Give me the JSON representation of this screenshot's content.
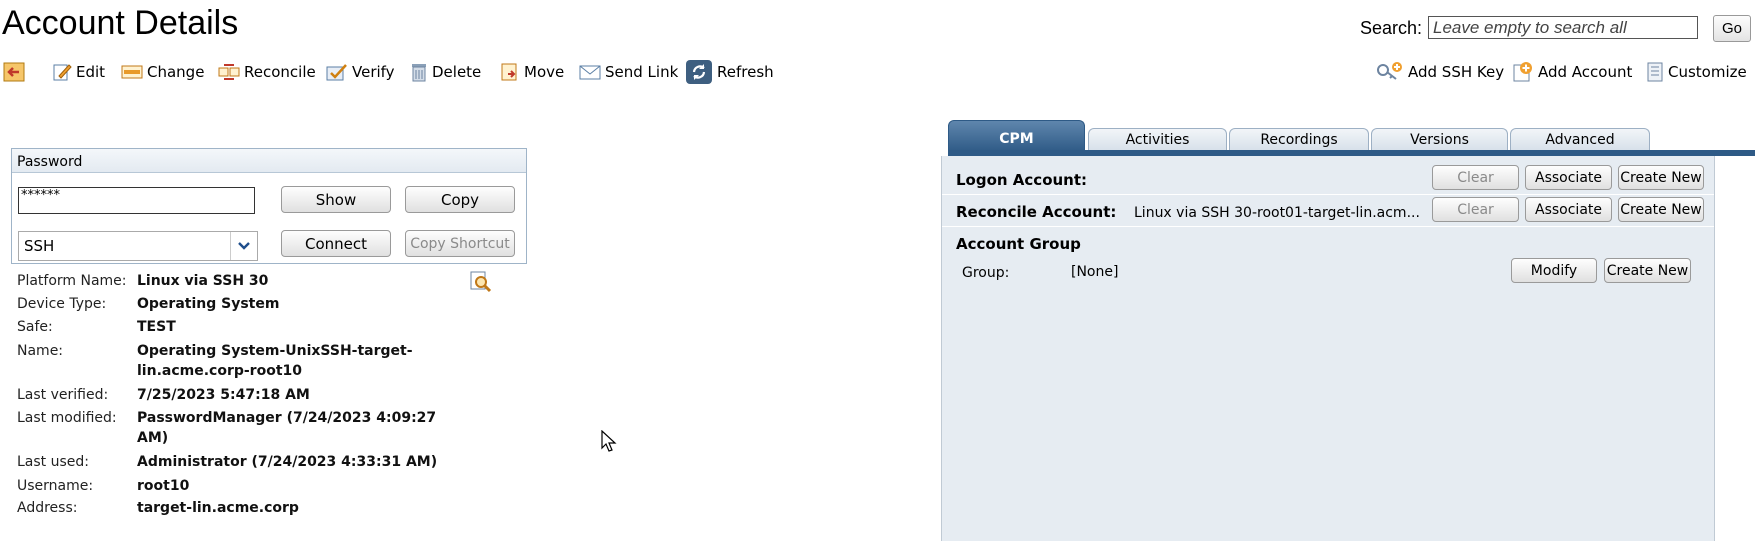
{
  "header": {
    "title": "Account Details",
    "search_label": "Search:",
    "search_placeholder": "Leave empty to search all",
    "go_label": "Go"
  },
  "toolbar": {
    "back_label": "",
    "items": [
      "Edit",
      "Change",
      "Reconcile",
      "Verify",
      "Delete",
      "Move",
      "Send Link",
      "Refresh"
    ],
    "right_items": [
      "Add SSH Key",
      "Add Account",
      "Customize"
    ]
  },
  "password_panel": {
    "header": "Password",
    "password_value": "******",
    "show_label": "Show",
    "copy_label": "Copy",
    "connection_component": "SSH",
    "connect_label": "Connect",
    "copy_shortcut_label": "Copy Shortcut"
  },
  "details": [
    {
      "label": "Platform Name:",
      "value": "Linux via SSH 30"
    },
    {
      "label": "Device Type:",
      "value": "Operating System"
    },
    {
      "label": "Safe:",
      "value": "TEST"
    },
    {
      "label": "Name:",
      "value": "Operating System-UnixSSH-target-\nlin.acme.corp-root10"
    },
    {
      "label": "Last verified:",
      "value": "7/25/2023 5:47:18 AM"
    },
    {
      "label": "Last modified:",
      "value": "PasswordManager (7/24/2023 4:09:27\nAM)"
    },
    {
      "label": "Last used:",
      "value": "Administrator (7/24/2023 4:33:31 AM)"
    },
    {
      "label": "Username:",
      "value": "root10"
    },
    {
      "label": "Address:",
      "value": "target-lin.acme.corp"
    }
  ],
  "tabs": [
    "CPM",
    "Activities",
    "Recordings",
    "Versions",
    "Advanced"
  ],
  "active_tab": "CPM",
  "cpm": {
    "logon_label": "Logon Account:",
    "logon_value": "",
    "reconcile_label": "Reconcile Account:",
    "reconcile_value": "Linux via SSH 30-root01-target-lin.acm...",
    "clear_label": "Clear",
    "associate_label": "Associate",
    "create_new_label": "Create New",
    "group_section": "Account Group",
    "group_label": "Group:",
    "group_value": "[None]",
    "modify_label": "Modify"
  },
  "colors": {
    "tab_active": "#2e5a86",
    "panel_bg": "#e6ecf2",
    "panel_border": "#9fb4c8"
  }
}
